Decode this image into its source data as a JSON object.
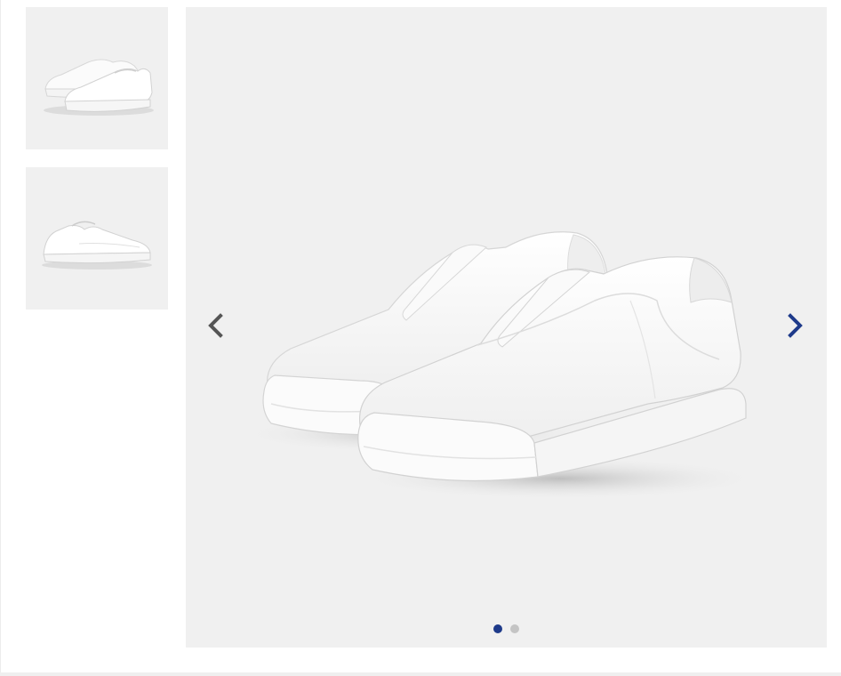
{
  "gallery": {
    "thumbnails": [
      {
        "image": "white-slip-on-sneaker-pair-side-view"
      },
      {
        "image": "white-slip-on-sneaker-profile-view"
      }
    ],
    "main_image": {
      "image": "white-slip-on-sneaker-pair-angled-view"
    },
    "prev_icon": "chevron-left-icon",
    "next_icon": "chevron-right-icon",
    "active_slide": 1,
    "total_slides": 2,
    "colors": {
      "background": "#f0f0f0",
      "prev_arrow": "#555555",
      "next_arrow": "#1e3a8a",
      "dot_active": "#1e3a8a",
      "dot_inactive": "#c4c4c4"
    }
  }
}
